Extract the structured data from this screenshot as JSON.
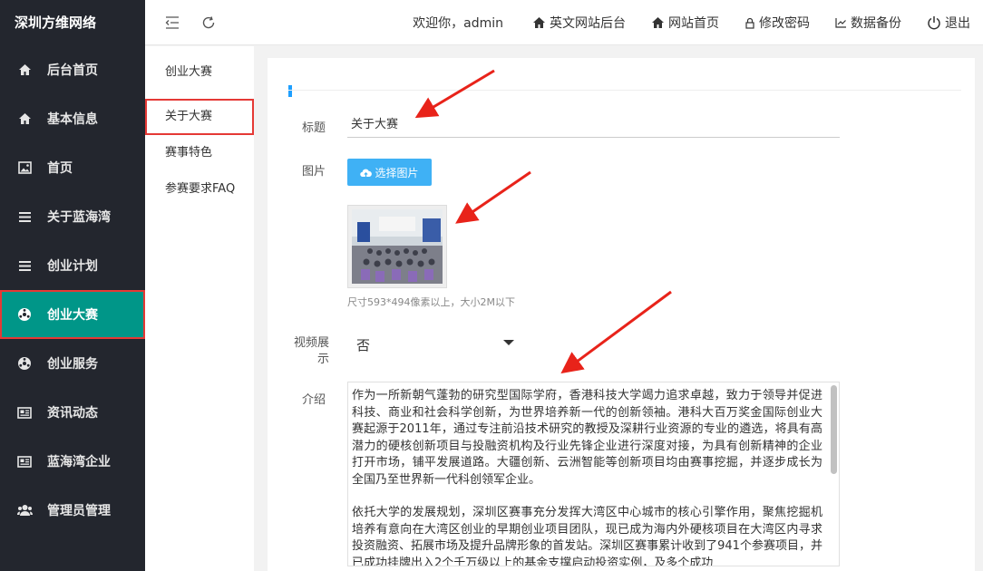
{
  "brand": "深圳方维网络",
  "sidebar": {
    "items": [
      {
        "label": "后台首页",
        "icon": "home-icon"
      },
      {
        "label": "基本信息",
        "icon": "home-icon"
      },
      {
        "label": "首页",
        "icon": "image-icon"
      },
      {
        "label": "关于蓝海湾",
        "icon": "list-icon"
      },
      {
        "label": "创业计划",
        "icon": "list-icon"
      },
      {
        "label": "创业大赛",
        "icon": "ball-icon",
        "active": true
      },
      {
        "label": "创业服务",
        "icon": "ball-icon"
      },
      {
        "label": "资讯动态",
        "icon": "news-icon"
      },
      {
        "label": "蓝海湾企业",
        "icon": "news-icon"
      },
      {
        "label": "管理员管理",
        "icon": "users-icon"
      }
    ]
  },
  "header": {
    "welcome": "欢迎你，admin",
    "links": [
      {
        "label": "英文网站后台",
        "icon": "home-icon"
      },
      {
        "label": "网站首页",
        "icon": "home-icon"
      },
      {
        "label": "修改密码",
        "icon": "lock-icon"
      },
      {
        "label": "数据备份",
        "icon": "chart-icon"
      },
      {
        "label": "退出",
        "icon": "power-icon"
      }
    ]
  },
  "submenu": {
    "items": [
      {
        "label": "创业大赛"
      },
      {
        "label": "关于大赛",
        "active": true
      },
      {
        "label": "赛事特色"
      },
      {
        "label": "参赛要求FAQ"
      }
    ]
  },
  "form": {
    "title_label": "标题",
    "title_value": "关于大赛",
    "image_label": "图片",
    "pick_button": "选择图片",
    "image_hint": "尺寸593*494像素以上，大小2M以下",
    "video_label": "视频展示",
    "video_value": "否",
    "intro_label": "介绍",
    "intro_paragraphs": [
      "作为一所新朝气蓬勃的研究型国际学府，香港科技大学竭力追求卓越，致力于领导并促进科技、商业和社会科学创新，为世界培养新一代的创新领袖。港科大百万奖金国际创业大赛起源于2011年，通过专注前沿技术研究的教授及深耕行业资源的专业的遴选，将具有高潜力的硬核创新项目与投融资机构及行业先锋企业进行深度对接，为具有创新精神的企业打开市场，铺平发展道路。大疆创新、云洲智能等创新项目均由赛事挖掘，并逐步成长为全国乃至世界新一代科创领军企业。",
      "依托大学的发展规划，深圳区赛事充分发挥大湾区中心城市的核心引擎作用，聚焦挖掘机培养有意向在大湾区创业的早期创业项目团队，现已成为海内外硬核项目在大湾区内寻求投资融资、拓展市场及提升品牌形象的首发站。深圳区赛事累计收到了941个参赛项目，并已成功挂牌出入2个千万级以上的基金支撑启动投资实例，及多个成功"
    ]
  }
}
